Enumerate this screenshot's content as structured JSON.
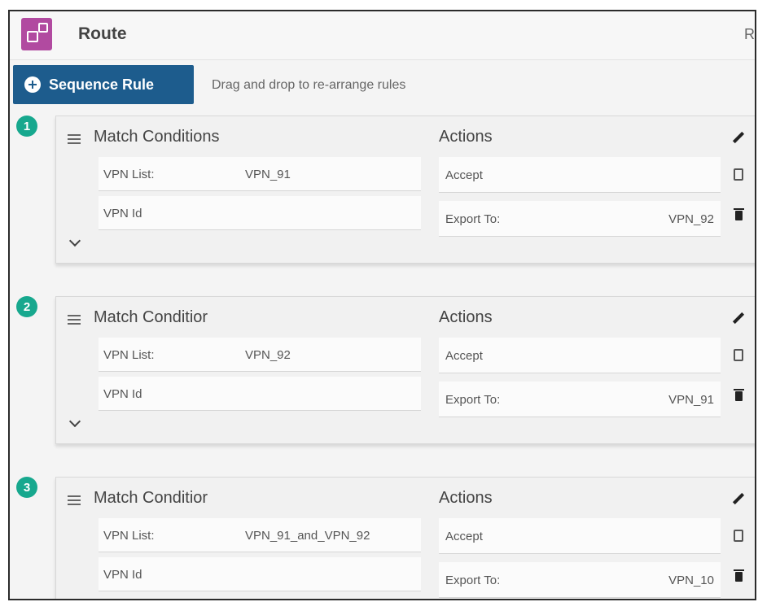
{
  "header": {
    "title": "Route",
    "right_text": "Ro"
  },
  "toolbar": {
    "sequence_rule_label": "Sequence Rule",
    "hint": "Drag and drop to re-arrange rules"
  },
  "rules": [
    {
      "number": "1",
      "match_title": "Match Conditions",
      "actions_title": "Actions",
      "vpn_list_label": "VPN List:",
      "vpn_list_value": "VPN_91",
      "vpn_id_label": "VPN Id",
      "accept_label": "Accept",
      "export_label": "Export To:",
      "export_value": "VPN_92"
    },
    {
      "number": "2",
      "match_title": "Match Conditior",
      "actions_title": "Actions",
      "vpn_list_label": "VPN List:",
      "vpn_list_value": "VPN_92",
      "vpn_id_label": "VPN Id",
      "accept_label": "Accept",
      "export_label": "Export To:",
      "export_value": "VPN_91"
    },
    {
      "number": "3",
      "match_title": "Match Conditior",
      "actions_title": "Actions",
      "vpn_list_label": "VPN List:",
      "vpn_list_value": "VPN_91_and_VPN_92",
      "vpn_id_label": "VPN Id",
      "accept_label": "Accept",
      "export_label": "Export To:",
      "export_value": "VPN_10"
    }
  ]
}
